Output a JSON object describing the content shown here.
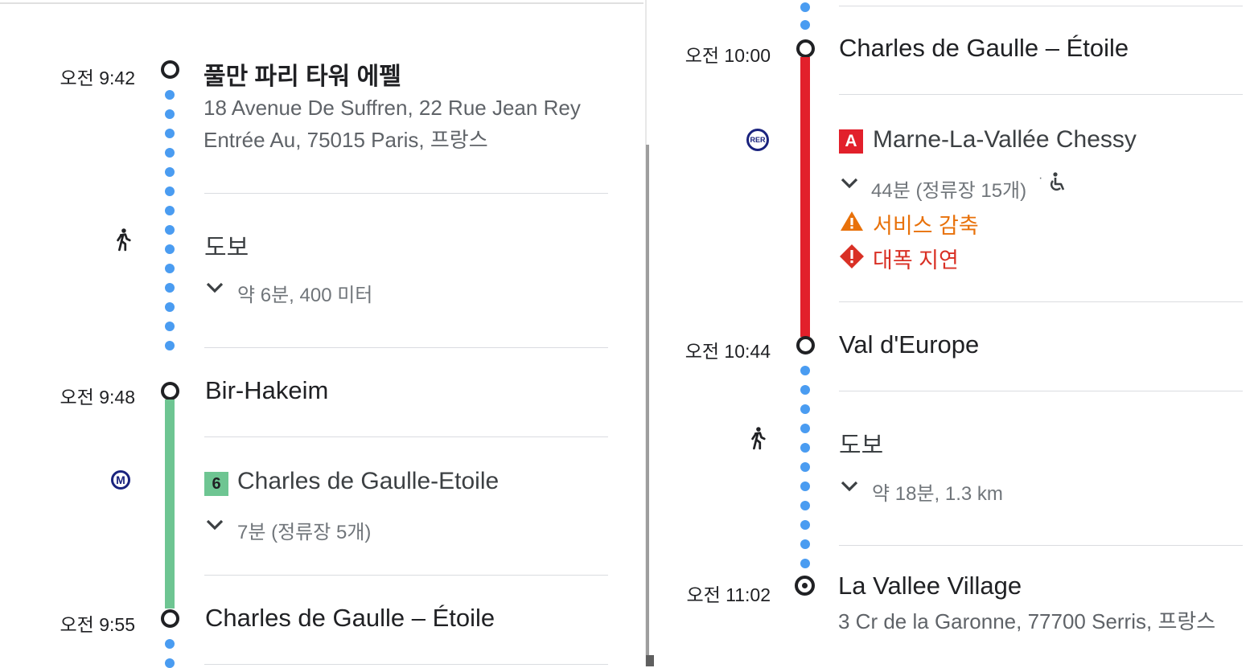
{
  "left": {
    "stop1": {
      "time": "오전 9:42",
      "name": "풀만 파리 타워 에펠",
      "address_line1": "18 Avenue De Suffren, 22 Rue Jean Rey",
      "address_line2": "Entrée Au, 75015 Paris, 프랑스"
    },
    "walk1": {
      "mode": "도보",
      "detail": "약 6분, 400 미터"
    },
    "stop2": {
      "time": "오전 9:48",
      "name": "Bir-Hakeim"
    },
    "metro": {
      "line": "6",
      "line_color": "#6ec592",
      "direction": "Charles de Gaulle-Etoile",
      "detail": "7분 (정류장 5개)",
      "icon_text": "M"
    },
    "stop3": {
      "time": "오전 9:55",
      "name": "Charles de Gaulle – Étoile"
    }
  },
  "right": {
    "stop1": {
      "time": "오전 10:00",
      "name": "Charles de Gaulle – Étoile"
    },
    "rer": {
      "line": "A",
      "line_color": "#e2202b",
      "direction": "Marne-La-Vallée Chessy",
      "detail": "44분 (정류장 15개)",
      "separator": "·",
      "icon_text": "RER",
      "alert_reduced": "서비스 감축",
      "alert_delay": "대폭 지연"
    },
    "stop2": {
      "time": "오전 10:44",
      "name": "Val d'Europe"
    },
    "walk": {
      "mode": "도보",
      "detail": "약 18분, 1.3 km"
    },
    "stop3": {
      "time": "오전 11:02",
      "name": "La Vallee Village",
      "address": "3 Cr de la Garonne, 77700 Serris, 프랑스"
    }
  },
  "colors": {
    "walk_dots": "#4a9cf1",
    "metro_line": "#6ec592",
    "rer_line": "#e2202b",
    "warning_orange": "#e8710a",
    "severe_red": "#d93025",
    "icon_navy": "#1a237e"
  },
  "icons": [
    "walk-icon",
    "metro-icon",
    "rer-icon",
    "chevron-down-icon",
    "wheelchair-icon",
    "warning-icon",
    "severe-alert-icon",
    "destination-icon"
  ]
}
